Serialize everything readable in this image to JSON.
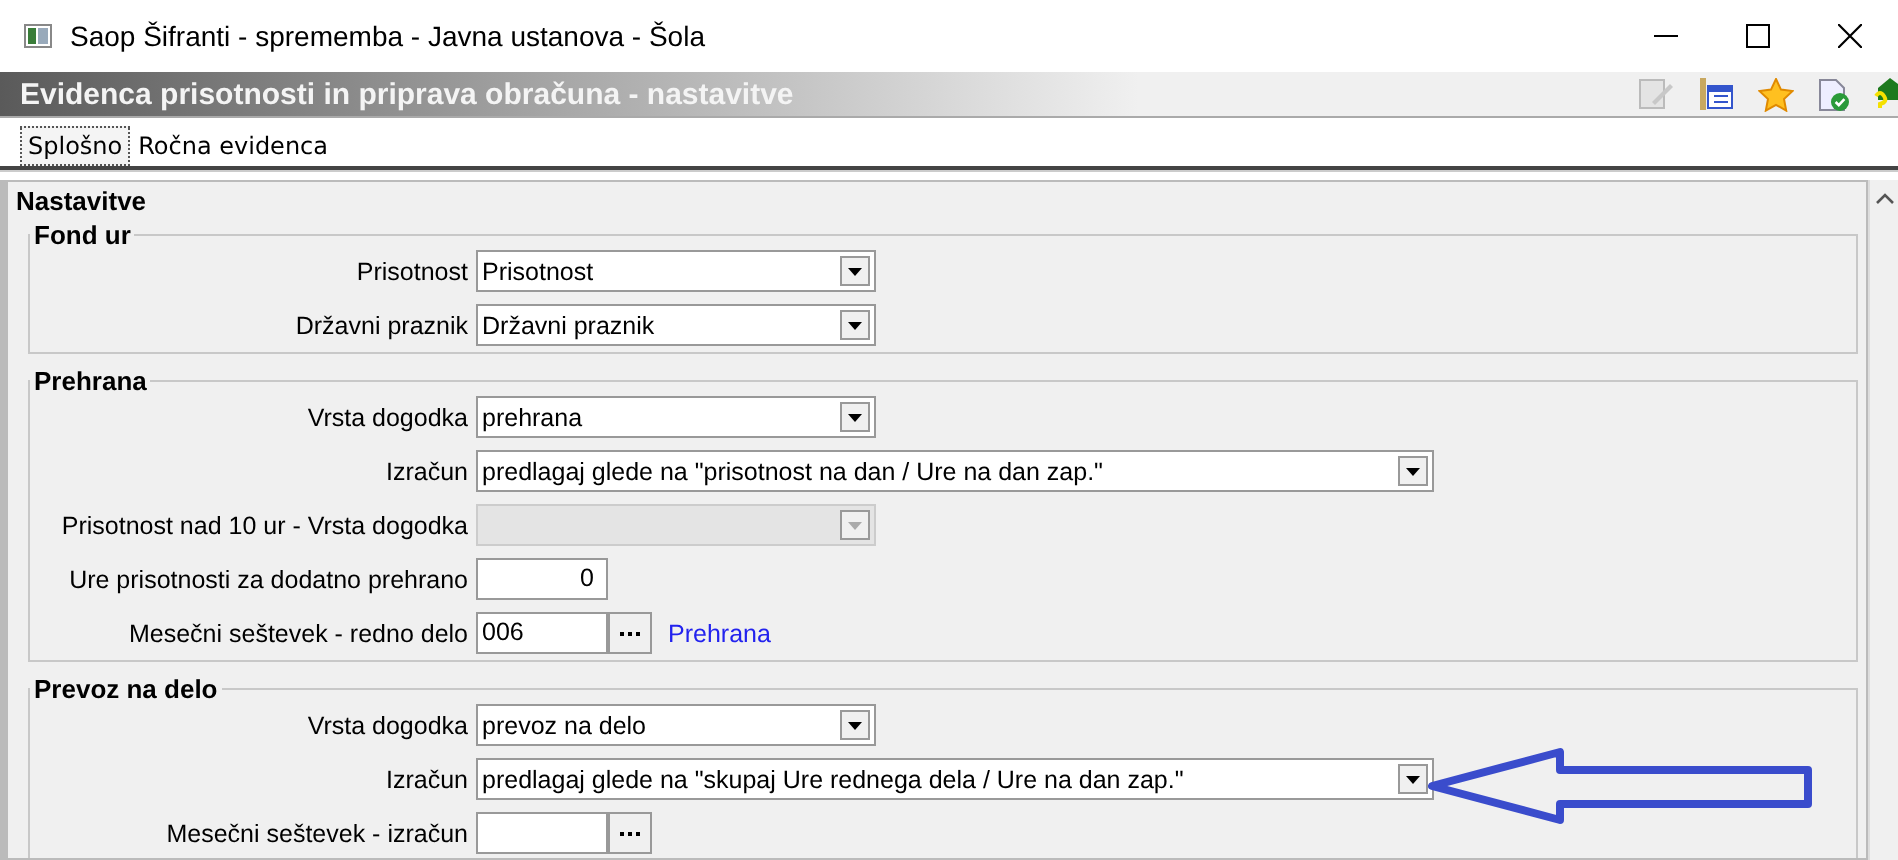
{
  "window": {
    "title": "Saop Šifranti - sprememba - Javna ustanova - Šola"
  },
  "header": {
    "title": "Evidenca prisotnosti in priprava obračuna - nastavitve"
  },
  "tabs": [
    {
      "label": "Splošno",
      "selected": true
    },
    {
      "label": "Ročna evidenca",
      "selected": false
    }
  ],
  "panel": {
    "title": "Nastavitve",
    "sections": [
      {
        "title": "Fond ur",
        "rows": [
          {
            "label": "Prisotnost",
            "kind": "combo",
            "value": "Prisotnost",
            "disabled": false
          },
          {
            "label": "Državni praznik",
            "kind": "combo",
            "value": "Državni praznik",
            "disabled": false
          }
        ]
      },
      {
        "title": "Prehrana",
        "rows": [
          {
            "label": "Vrsta dogodka",
            "kind": "combo",
            "value": "prehrana",
            "disabled": false
          },
          {
            "label": "Izračun",
            "kind": "longcombo",
            "value": "predlagaj glede na \"prisotnost na dan / Ure na dan zap.\"",
            "disabled": false
          },
          {
            "label": "Prisotnost nad 10 ur - Vrsta dogodka",
            "kind": "combo",
            "disabled": true
          },
          {
            "label": "Ure prisotnosti za dodatno prehrano",
            "kind": "number",
            "value": "0",
            "disabled": false
          },
          {
            "label": "Mesečni seštevek - redno delo",
            "kind": "lookup",
            "value": "006",
            "link": "Prehrana",
            "disabled": false
          }
        ]
      },
      {
        "title": "Prevoz na delo",
        "rows": [
          {
            "label": "Vrsta dogodka",
            "kind": "combo",
            "value": "prevoz na delo",
            "disabled": false
          },
          {
            "label": "Izračun",
            "kind": "longcombo",
            "value": "predlagaj glede na \"skupaj Ure rednega dela / Ure na dan zap.\"",
            "disabled": false
          },
          {
            "label": "Mesečni seštevek - izračun",
            "kind": "lookup",
            "disabled": false
          }
        ]
      }
    ]
  }
}
